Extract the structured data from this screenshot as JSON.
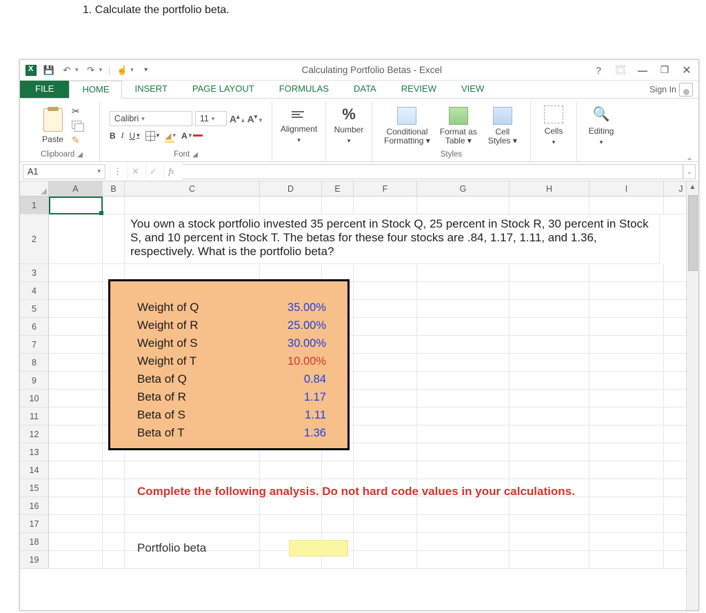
{
  "page": {
    "instruction": "1. Calculate the portfolio beta."
  },
  "titlebar": {
    "document_title": "Calculating Portfolio Betas - Excel"
  },
  "tabs": {
    "file": "FILE",
    "items": [
      "HOME",
      "INSERT",
      "PAGE LAYOUT",
      "FORMULAS",
      "DATA",
      "REVIEW",
      "VIEW"
    ],
    "active_index": 0,
    "signin": "Sign In"
  },
  "ribbon": {
    "clipboard": {
      "paste": "Paste",
      "label": "Clipboard"
    },
    "font": {
      "name": "Calibri",
      "size": "11",
      "label": "Font"
    },
    "alignment": {
      "button": "Alignment"
    },
    "number": {
      "button": "Number",
      "symbol": "%"
    },
    "styles": {
      "cond": "Conditional Formatting",
      "fmtas": "Format as Table",
      "cellstyles": "Cell Styles",
      "label": "Styles"
    },
    "cells": {
      "button": "Cells"
    },
    "editing": {
      "button": "Editing"
    }
  },
  "namebox": "A1",
  "columns": [
    "A",
    "B",
    "C",
    "D",
    "E",
    "F",
    "G",
    "H",
    "I",
    "J"
  ],
  "rows": [
    "1",
    "2",
    "3",
    "4",
    "5",
    "6",
    "7",
    "8",
    "9",
    "10",
    "11",
    "12",
    "13",
    "14",
    "15",
    "16",
    "17",
    "18",
    "19"
  ],
  "sheet": {
    "question": "You own a stock portfolio invested 35 percent in Stock Q, 25 percent in Stock R, 30 percent in Stock S, and 10 percent in Stock T. The betas for these four stocks are .84, 1.17, 1.11, and 1.36, respectively. What is the portfolio beta?",
    "inputs": [
      {
        "label": "Weight of Q",
        "value": "35.00%",
        "color": "blue"
      },
      {
        "label": "Weight of R",
        "value": "25.00%",
        "color": "blue"
      },
      {
        "label": "Weight of S",
        "value": "30.00%",
        "color": "blue"
      },
      {
        "label": "Weight of T",
        "value": "10.00%",
        "color": "red"
      },
      {
        "label": "Beta of Q",
        "value": "0.84",
        "color": "blue"
      },
      {
        "label": "Beta of R",
        "value": "1.17",
        "color": "blue"
      },
      {
        "label": "Beta of S",
        "value": "1.11",
        "color": "blue"
      },
      {
        "label": "Beta of T",
        "value": "1.36",
        "color": "blue"
      }
    ],
    "instruction": "Complete the following analysis. Do not hard code values in your calculations.",
    "result_label": "Portfolio beta"
  }
}
